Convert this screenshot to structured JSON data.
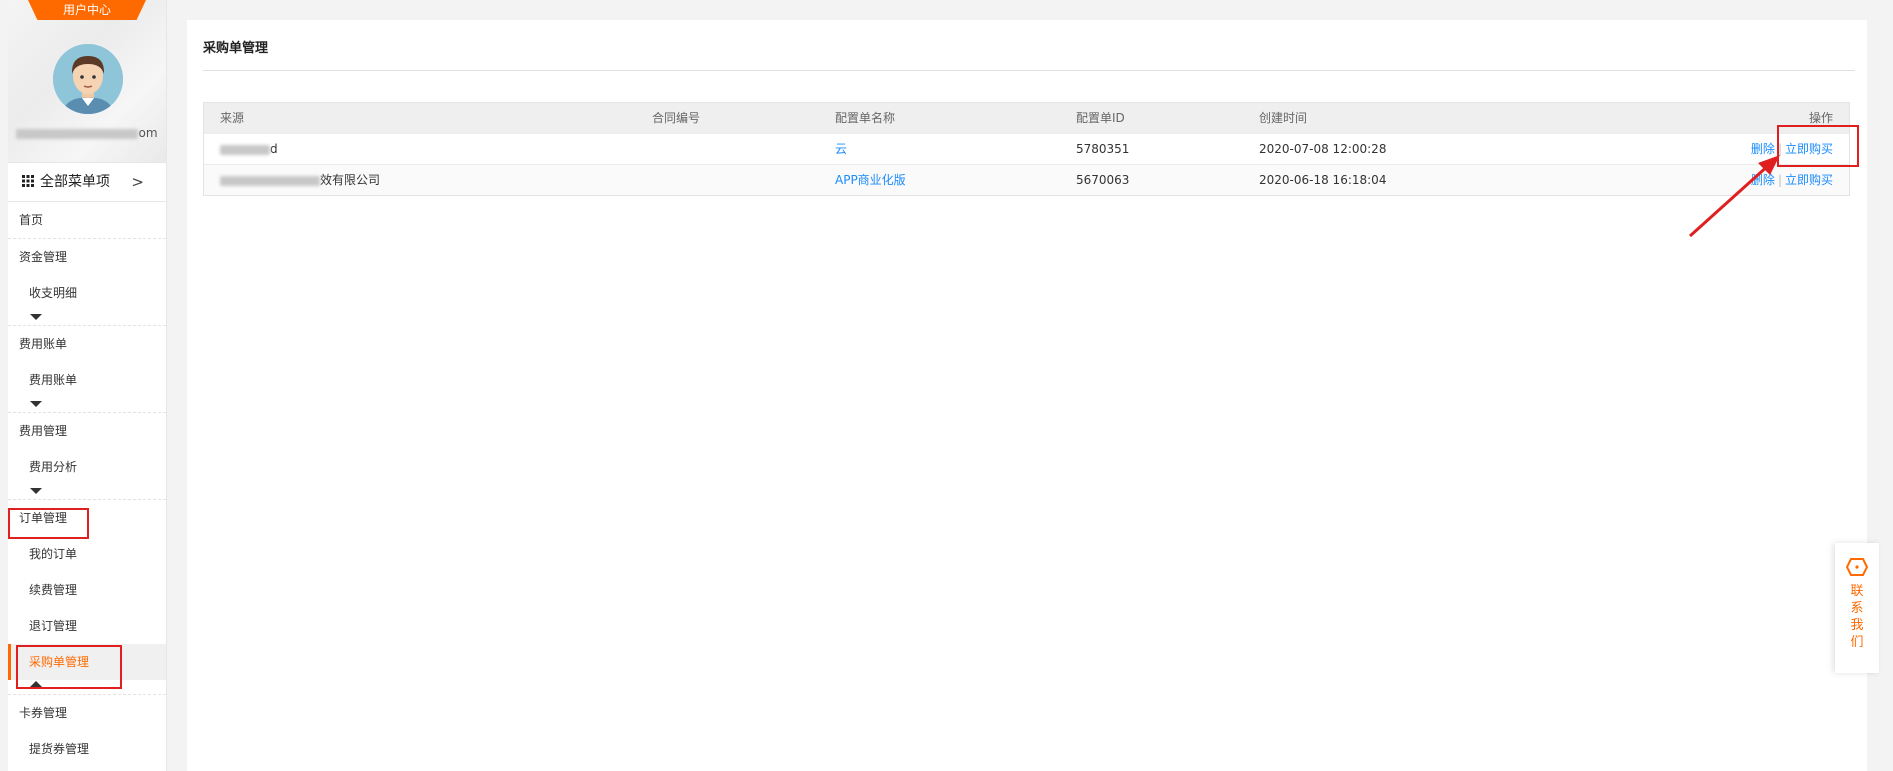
{
  "sidebar": {
    "badge": "用户中心",
    "email_suffix": "om",
    "all_menu": "全部菜单项",
    "nav": {
      "home": "首页",
      "funds": "资金管理",
      "funds_detail": "收支明细",
      "bills": "费用账单",
      "bills_sub": "费用账单",
      "fee_mgmt": "费用管理",
      "fee_analysis": "费用分析",
      "orders": "订单管理",
      "my_orders": "我的订单",
      "renewal": "续费管理",
      "unsubscribe": "退订管理",
      "purchase": "采购单管理",
      "coupons": "卡券管理",
      "pickup": "提货券管理"
    }
  },
  "main": {
    "title": "采购单管理",
    "columns": [
      "来源",
      "合同编号",
      "配置单名称",
      "配置单ID",
      "创建时间",
      "操作"
    ],
    "rows": [
      {
        "source_suffix": "d",
        "contract": "",
        "name": "云",
        "id": "5780351",
        "created": "2020-07-08 12:00:28",
        "delete": "删除",
        "buy": "立即购买"
      },
      {
        "source_suffix": "效有限公司",
        "contract": "",
        "name": "APP商业化版",
        "id": "5670063",
        "created": "2020-06-18 16:18:04",
        "delete": "删除",
        "buy": "立即购买"
      }
    ]
  },
  "contact": "联系我们",
  "colors": {
    "accent": "#ff6a00",
    "link": "#1a8cff",
    "highlight": "#e02020"
  }
}
